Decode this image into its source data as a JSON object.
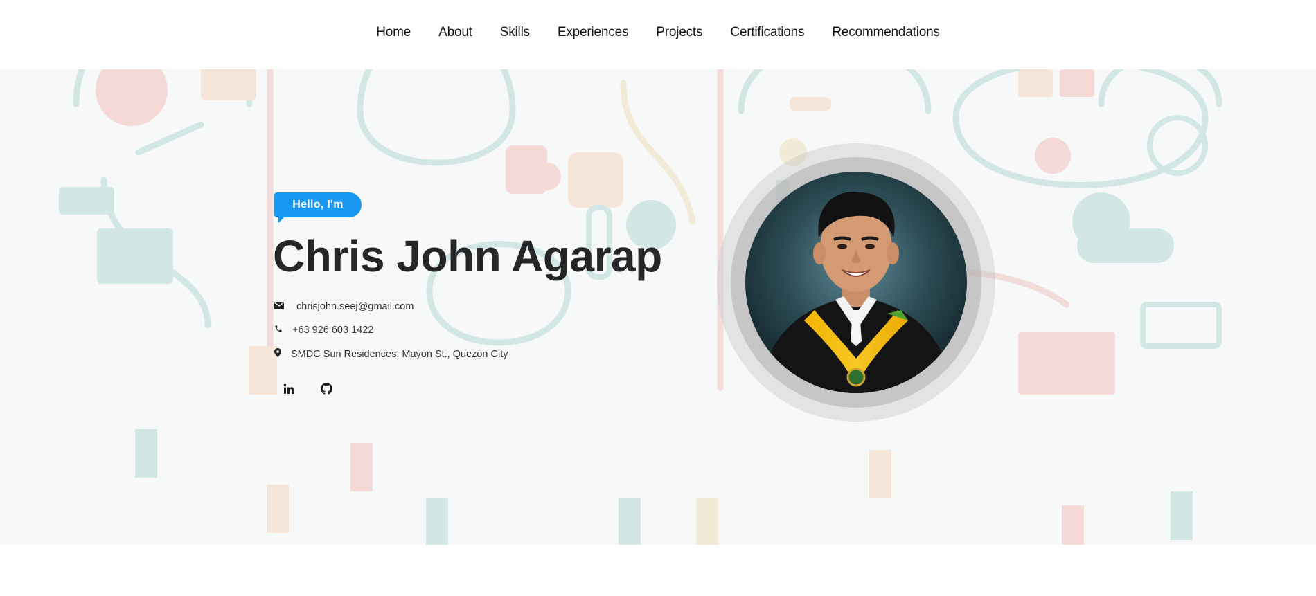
{
  "nav": {
    "items": [
      {
        "label": "Home"
      },
      {
        "label": "About"
      },
      {
        "label": "Skills"
      },
      {
        "label": "Experiences"
      },
      {
        "label": "Projects"
      },
      {
        "label": "Certifications"
      },
      {
        "label": "Recommendations"
      }
    ]
  },
  "hero": {
    "greeting": "Hello, I'm",
    "name": "Chris John Agarap",
    "contact": {
      "email": "chrisjohn.seej@gmail.com",
      "phone": "+63 926 603 1422",
      "address": "SMDC Sun Residences, Mayon St., Quezon City"
    },
    "social": [
      {
        "icon": "linkedin-icon"
      },
      {
        "icon": "github-icon"
      }
    ]
  },
  "colors": {
    "accent": "#1a97ee",
    "heading": "#262528",
    "nav_text": "#151515"
  }
}
